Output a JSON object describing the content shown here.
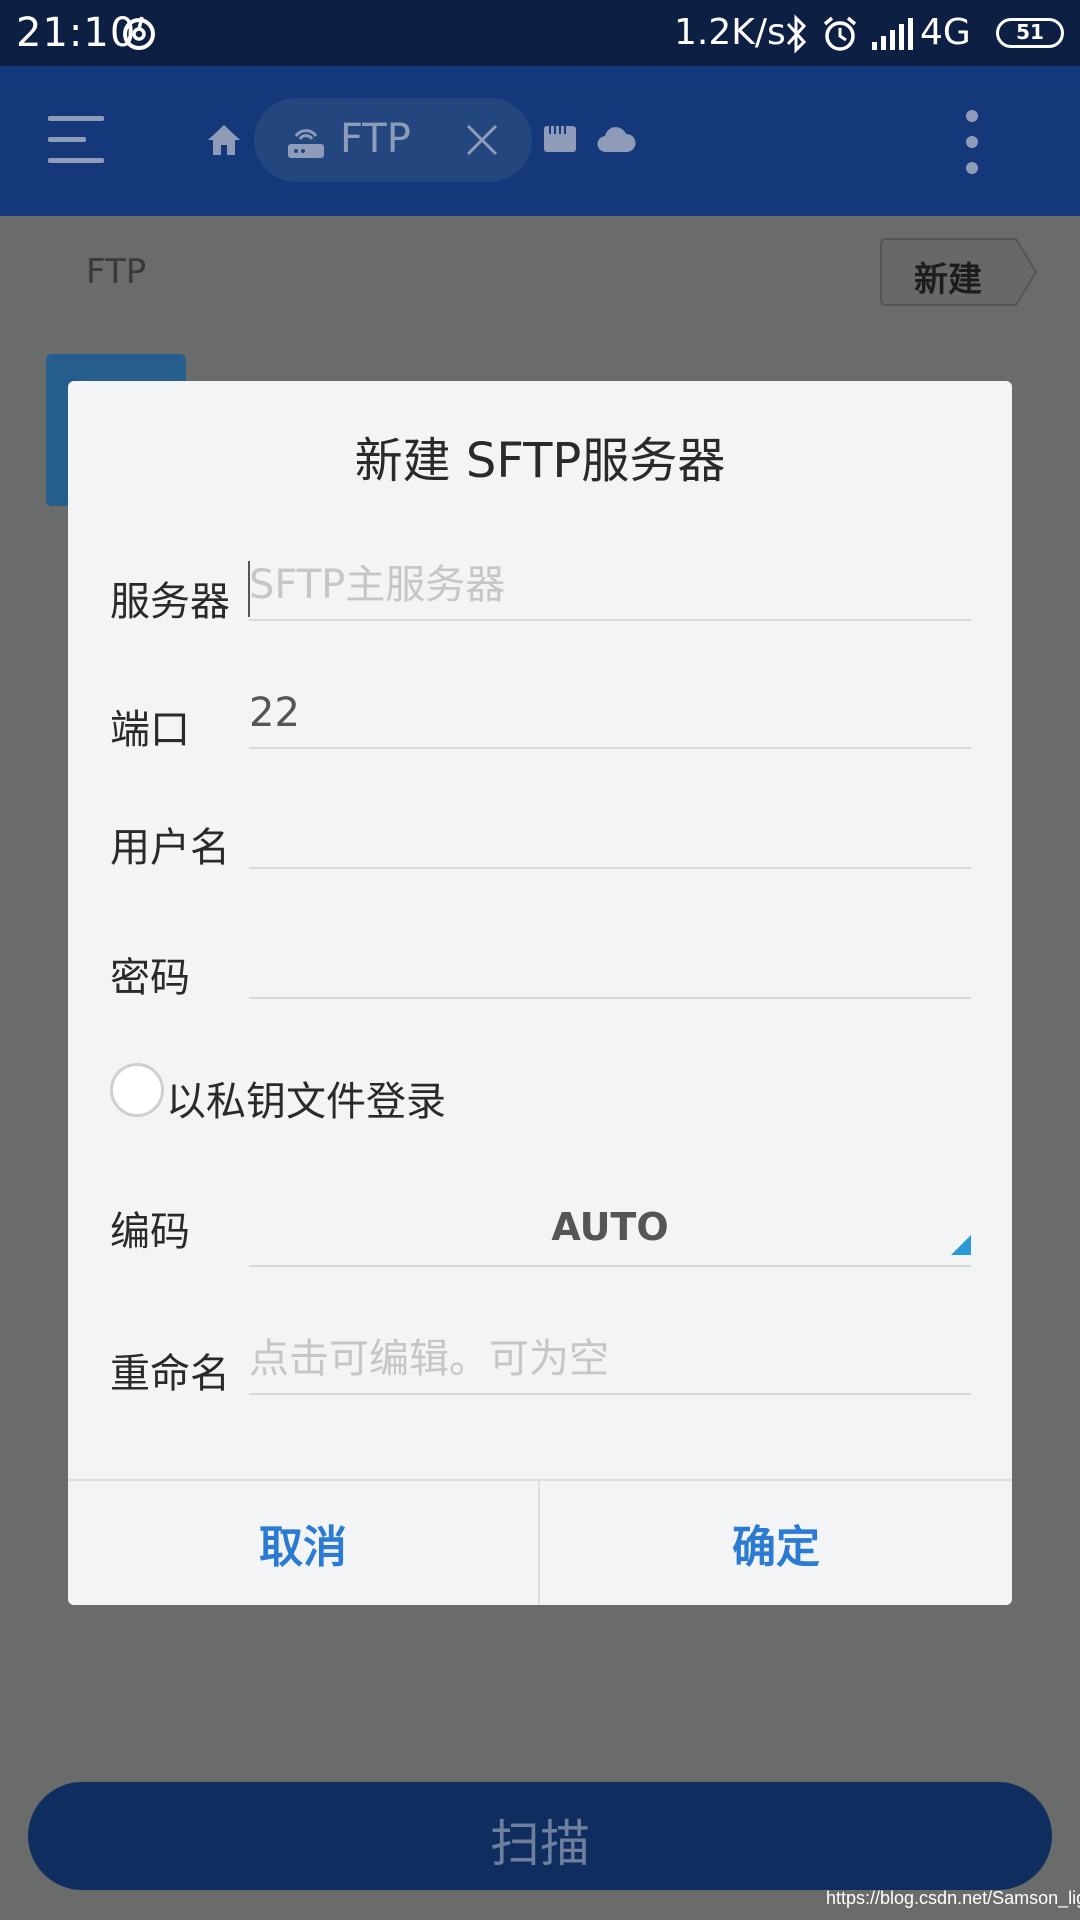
{
  "status_bar": {
    "time": "21:10",
    "net_speed": "1.2K/s",
    "network": "4G",
    "battery": "51"
  },
  "app_bar": {
    "tab_label": "FTP"
  },
  "location": {
    "breadcrumb": "FTP",
    "new_button": "新建"
  },
  "dialog": {
    "title": "新建 SFTP服务器",
    "server": {
      "label": "服务器",
      "placeholder": "SFTP主服务器",
      "value": ""
    },
    "port": {
      "label": "端口",
      "value": "22"
    },
    "username": {
      "label": "用户名",
      "value": ""
    },
    "password": {
      "label": "密码",
      "value": ""
    },
    "key_login": {
      "label": "以私钥文件登录",
      "checked": false
    },
    "encoding": {
      "label": "编码",
      "value": "AUTO"
    },
    "rename": {
      "label": "重命名",
      "placeholder": "点击可编辑。可为空",
      "value": ""
    },
    "cancel_label": "取消",
    "ok_label": "确定"
  },
  "scan_button": "扫描",
  "watermark": "https://blog.csdn.net/Samson_light",
  "colors": {
    "status_bar": "#0e1f44",
    "app_bar": "#14387a",
    "dialog_bg": "#f3f4f6",
    "dialog_action": "#2b7ad3",
    "scrim_bg": "#6a6b6b",
    "scan_button": "#0f2d5e"
  },
  "icons": [
    "netease-music-icon",
    "bluetooth-icon",
    "alarm-icon",
    "signal-icon",
    "battery-icon",
    "menu-icon",
    "home-icon",
    "router-icon",
    "close-icon",
    "sd-card-icon",
    "cloud-icon",
    "more-vertical-icon",
    "dropdown-arrow-icon"
  ]
}
